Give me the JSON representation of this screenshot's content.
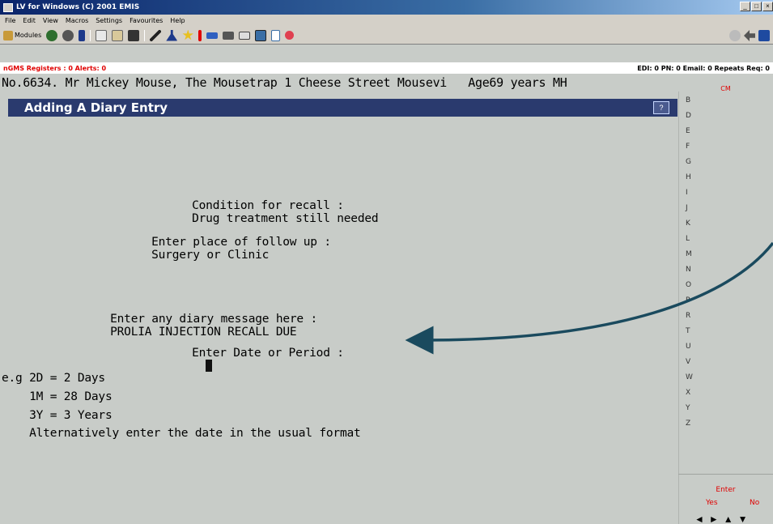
{
  "window": {
    "title": "LV for Windows (C) 2001 EMIS",
    "controls": [
      "_",
      "□",
      "×"
    ]
  },
  "menu": [
    "File",
    "Edit",
    "View",
    "Macros",
    "Settings",
    "Favourites",
    "Help"
  ],
  "toolbar": {
    "modules_label": "Modules",
    "icons": [
      "patient-icon",
      "settings-icon",
      "book-icon",
      "copy-icon",
      "paste-icon",
      "folder-icon",
      "pen-icon",
      "flask-icon",
      "star-icon",
      "alert-icon",
      "card-icon",
      "list-icon",
      "mail-icon",
      "monitor-icon",
      "doc-icon",
      "heart-icon"
    ],
    "right_icons": [
      "help-icon",
      "back-icon",
      "save-icon"
    ]
  },
  "status": {
    "left": "nGMS Registers : 0  Alerts: 0",
    "right": "EDI: 0  PN: 0  Email: 0  Repeats Req: 0"
  },
  "patient": {
    "line": "No.6634. Mr Mickey Mouse, The Mousetrap 1 Cheese Street Mousevi   Age69 years MH"
  },
  "entry": {
    "title": "Adding A Diary Entry",
    "icon": "help-icon"
  },
  "form": {
    "condition_label": "Condition for recall :",
    "condition_value": "Drug treatment still needed",
    "place_label": "Enter place of follow up :",
    "place_value": "Surgery or Clinic",
    "message_label": "Enter any diary message here :",
    "message_value": "PROLIA INJECTION RECALL DUE",
    "date_label": "Enter Date or Period :",
    "help": [
      "e.g 2D = 2 Days",
      "    1M = 28 Days",
      "    3Y = 3 Years",
      "    Alternatively enter the date in the usual format"
    ]
  },
  "sidebar": {
    "header": "CM",
    "letters": [
      "B",
      "D",
      "E",
      "F",
      "G",
      "H",
      "I",
      "J",
      "K",
      "L",
      "M",
      "N",
      "O",
      "P",
      "R",
      "T",
      "U",
      "V",
      "W",
      "X",
      "Y",
      "Z"
    ],
    "enter_label": "Enter",
    "yes_label": "Yes",
    "no_label": "No"
  },
  "colors": {
    "header_bg": "#2a3a6e",
    "alert_red": "#e00000",
    "callout_arrow": "#1a4a5e",
    "screen_bg": "#c8ccc8"
  }
}
